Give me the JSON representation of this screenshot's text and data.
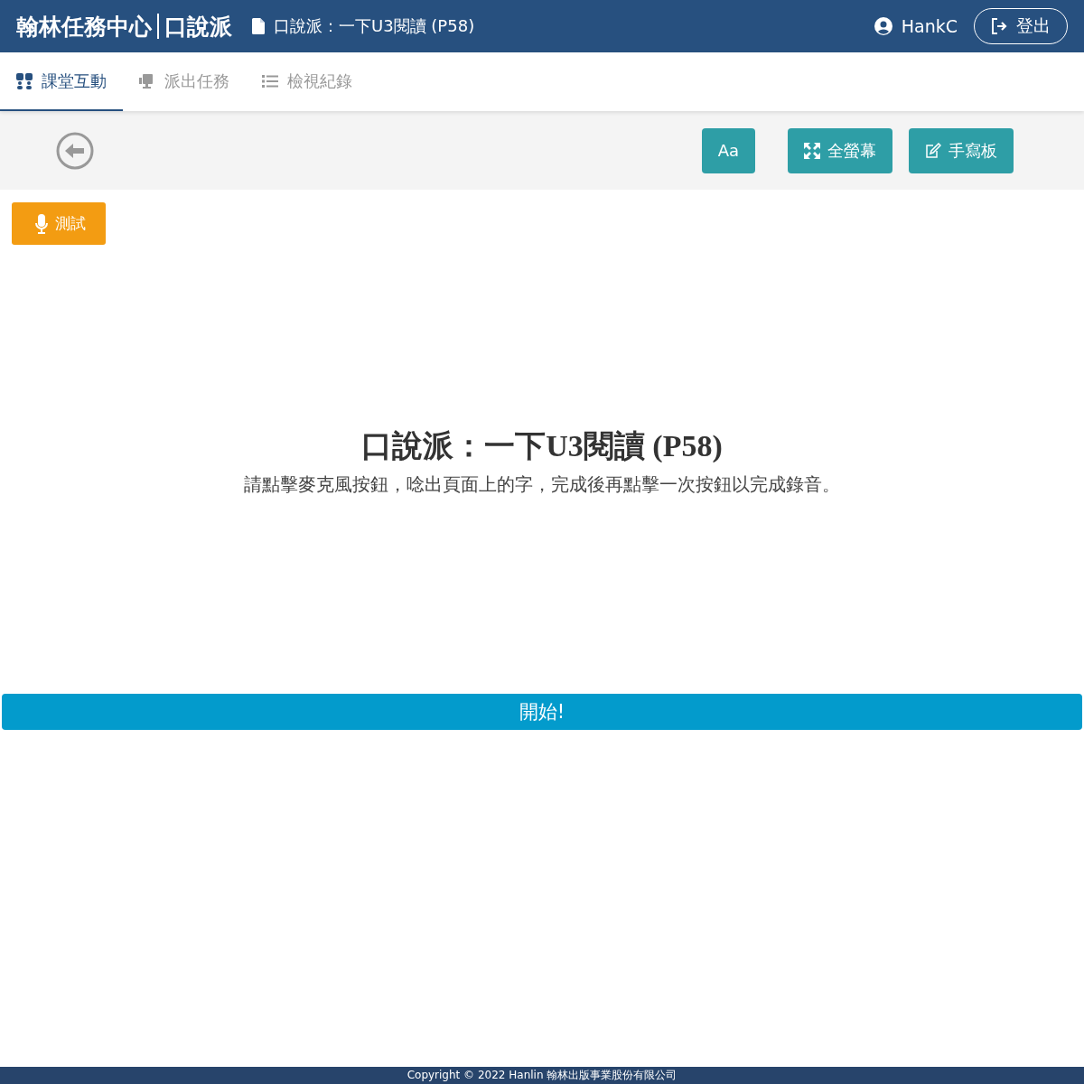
{
  "header": {
    "brand": "翰林任務中心",
    "app": "口說派",
    "document": "口說派：一下U3閱讀 (P58)",
    "user": "HankC",
    "logout": "登出"
  },
  "tabs": [
    {
      "label": "課堂互動",
      "kind": "qa",
      "selected": true
    },
    {
      "label": "派出任務",
      "kind": "send",
      "selected": false
    },
    {
      "label": "檢視紀錄",
      "kind": "list",
      "selected": false
    }
  ],
  "toolbar": {
    "buttons": [
      {
        "label": "Aa",
        "kind": "text"
      },
      {
        "label": "全螢幕",
        "kind": "fullscreen"
      },
      {
        "label": "手寫板",
        "kind": "pen"
      }
    ]
  },
  "test_button": "測試",
  "heading": "口說派：一下U3閱讀 (P58)",
  "instruction": "請點擊麥克風按鈕，唸出頁面上的字，完成後再點擊一次按鈕以完成錄音。",
  "start_button": "開始!",
  "footer": "Copyright © 2022 Hanlin 翰林出版事業股份有限公司"
}
